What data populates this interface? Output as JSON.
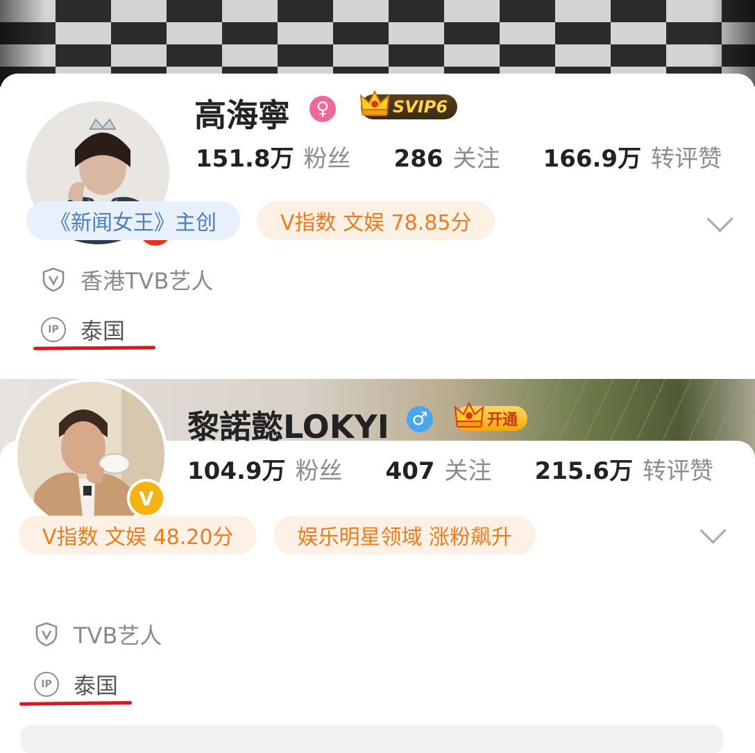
{
  "profiles": [
    {
      "name": "高海寧",
      "gender": "female",
      "gender_symbol": "♀",
      "vip_label": "SVIP6",
      "stats": [
        {
          "value": "151.8万",
          "label": "粉丝"
        },
        {
          "value": "286",
          "label": "关注"
        },
        {
          "value": "166.9万",
          "label": "转评赞"
        }
      ],
      "tags": [
        {
          "text": "《新闻女王》主创",
          "style": "blue"
        },
        {
          "text": "V指数 文娱 78.85分",
          "style": "orange"
        }
      ],
      "certification": "香港TVB艺人",
      "ip_icon_text": "IP",
      "ip_location": "泰国",
      "verified_badge": "V",
      "verified_color": "#e8311c"
    },
    {
      "name": "黎諾懿LOKYI",
      "gender": "male",
      "gender_symbol": "♂",
      "vip_label": "开通",
      "stats": [
        {
          "value": "104.9万",
          "label": "粉丝"
        },
        {
          "value": "407",
          "label": "关注"
        },
        {
          "value": "215.6万",
          "label": "转评赞"
        }
      ],
      "tags": [
        {
          "text": "V指数 文娱 48.20分",
          "style": "orange"
        },
        {
          "text": "娱乐明星领域 涨粉飙升",
          "style": "orange"
        }
      ],
      "certification": "TVB艺人",
      "ip_icon_text": "IP",
      "ip_location": "泰国",
      "verified_badge": "V",
      "verified_color": "#f5b40f"
    }
  ],
  "icons": {
    "verified": "verified-v-icon",
    "certification": "shield-v-icon",
    "ip": "ip-location-icon",
    "expand": "chevron-down-icon",
    "vip": "crown-icon"
  },
  "colors": {
    "tag_blue_bg": "#e8f0fb",
    "tag_blue_text": "#4a7ebf",
    "tag_orange_bg": "#fdf0e4",
    "tag_orange_text": "#f07a1e",
    "annotation_red": "#e0141c"
  }
}
